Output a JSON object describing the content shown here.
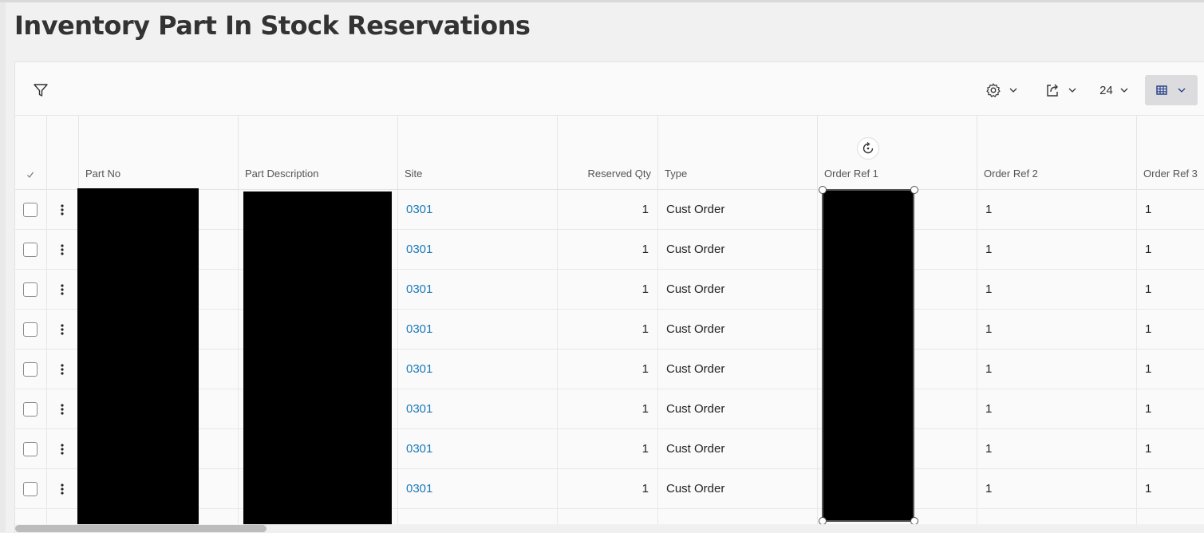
{
  "page": {
    "title": "Inventory Part In Stock Reservations"
  },
  "toolbar": {
    "filter_icon": "filter-icon",
    "settings_icon": "gear-icon",
    "export_icon": "export-icon",
    "page_size": "24",
    "view_icon": "table-view-icon"
  },
  "table": {
    "columns": [
      {
        "label": "Part No"
      },
      {
        "label": "Part Description"
      },
      {
        "label": "Site"
      },
      {
        "label": "Reserved Qty"
      },
      {
        "label": "Type"
      },
      {
        "label": "Order Ref 1"
      },
      {
        "label": "Order Ref 2"
      },
      {
        "label": "Order Ref 3"
      }
    ],
    "rows": [
      {
        "site": "0301",
        "reserved_qty": "1",
        "type": "Cust Order",
        "order_ref_2": "1",
        "order_ref_3": "1"
      },
      {
        "site": "0301",
        "reserved_qty": "1",
        "type": "Cust Order",
        "order_ref_2": "1",
        "order_ref_3": "1"
      },
      {
        "site": "0301",
        "reserved_qty": "1",
        "type": "Cust Order",
        "order_ref_2": "1",
        "order_ref_3": "1"
      },
      {
        "site": "0301",
        "reserved_qty": "1",
        "type": "Cust Order",
        "order_ref_2": "1",
        "order_ref_3": "1"
      },
      {
        "site": "0301",
        "reserved_qty": "1",
        "type": "Cust Order",
        "order_ref_2": "1",
        "order_ref_3": "1"
      },
      {
        "site": "0301",
        "reserved_qty": "1",
        "type": "Cust Order",
        "order_ref_2": "1",
        "order_ref_3": "1"
      },
      {
        "site": "0301",
        "reserved_qty": "1",
        "type": "Cust Order",
        "order_ref_2": "1",
        "order_ref_3": "1"
      },
      {
        "site": "0301",
        "reserved_qty": "1",
        "type": "Cust Order",
        "order_ref_2": "1",
        "order_ref_3": "1"
      }
    ]
  },
  "colors": {
    "link": "#1a7ab8",
    "redaction": "#000000"
  }
}
